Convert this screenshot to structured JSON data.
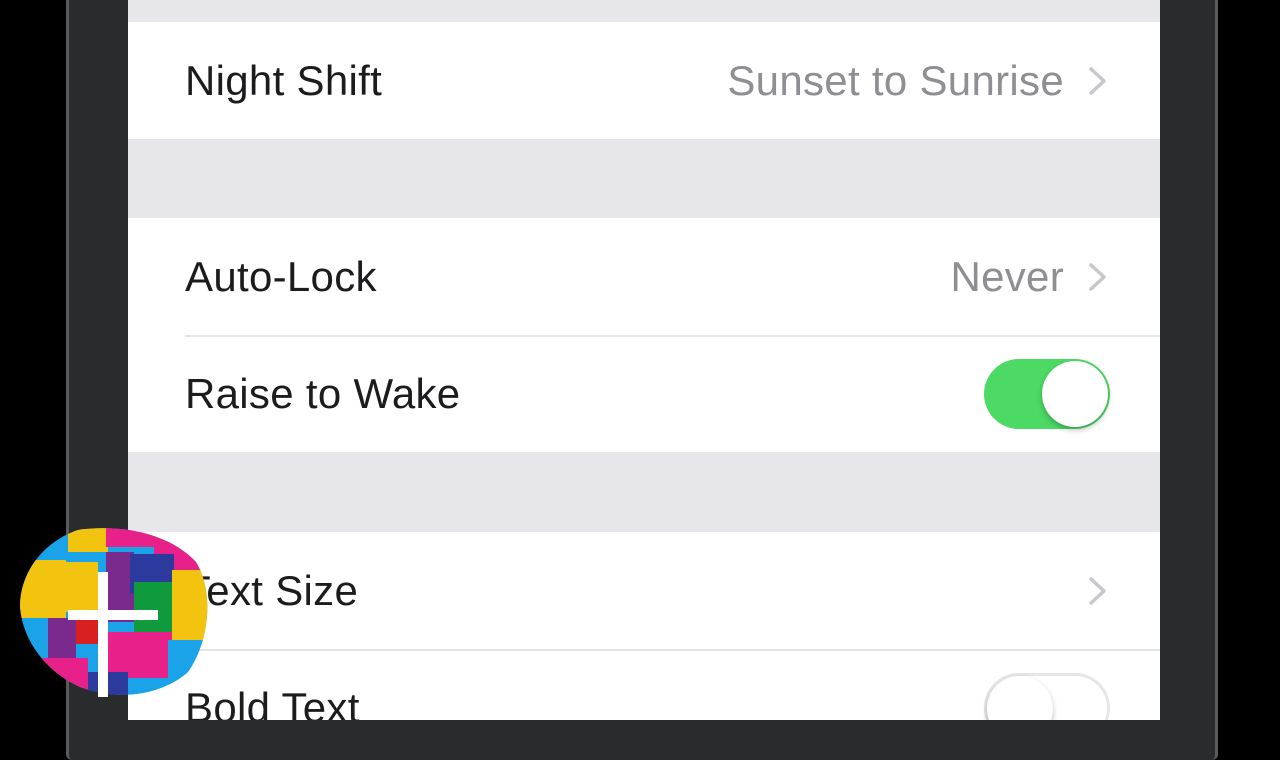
{
  "settings": {
    "night_shift": {
      "label": "Night Shift",
      "value": "Sunset to Sunrise"
    },
    "auto_lock": {
      "label": "Auto-Lock",
      "value": "Never"
    },
    "raise_to_wake": {
      "label": "Raise to Wake",
      "enabled": true
    },
    "text_size": {
      "label": "Text Size"
    },
    "bold_text": {
      "label": "Bold Text",
      "enabled": false
    }
  },
  "icons": {
    "chevron": "chevron-right-icon",
    "logo": "channel-logo"
  },
  "colors": {
    "toggle_on": "#4cd964",
    "secondary_text": "#8e8e93",
    "group_background": "#e6e6eb"
  }
}
